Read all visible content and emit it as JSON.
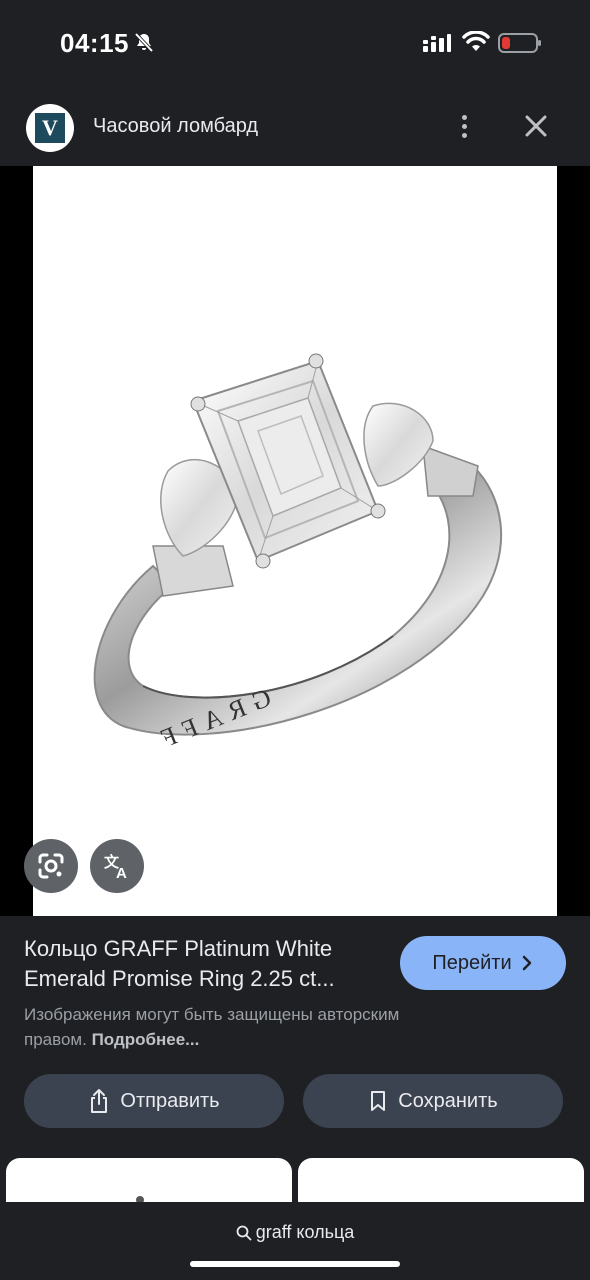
{
  "status_bar": {
    "time": "04:15"
  },
  "header": {
    "site_name": "Часовой ломбард",
    "logo_letter": "V"
  },
  "image": {
    "engraving": "GRAFF"
  },
  "result": {
    "title": "Кольцо GRAFF Platinum White Emerald Promise Ring 2.25 ct...",
    "go_label": "Перейти",
    "copyright_text": "Изображения могут быть защищены авторским правом.",
    "more_link": "Подробнее..."
  },
  "actions": {
    "share_label": "Отправить",
    "save_label": "Сохранить"
  },
  "search": {
    "query": "graff кольца"
  },
  "icons": [
    "bell-slash-icon",
    "signal-icon",
    "wifi-icon",
    "battery-icon",
    "more-vert-icon",
    "close-icon",
    "google-lens-icon",
    "translate-icon",
    "chevron-right-icon",
    "share-icon",
    "bookmark-icon",
    "search-icon"
  ],
  "colors": {
    "background": "#1f2023",
    "accent": "#8ab4f8",
    "button": "#3c4350",
    "battery_low": "#e53935"
  }
}
